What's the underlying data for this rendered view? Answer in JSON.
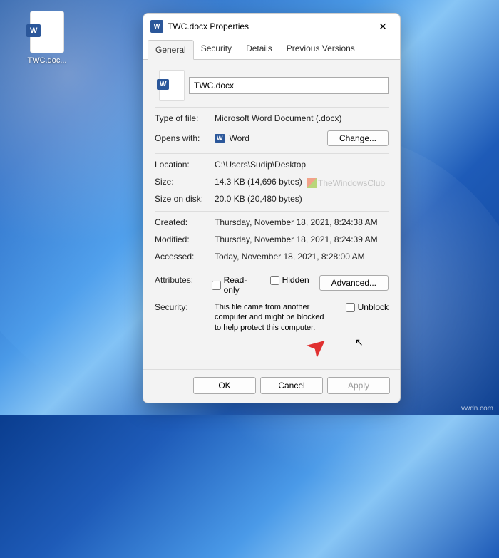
{
  "desktop": {
    "file_label": "TWC.doc..."
  },
  "dialog": {
    "title": "TWC.docx Properties",
    "close": "✕",
    "tabs": {
      "general": "General",
      "security": "Security",
      "details": "Details",
      "previous": "Previous Versions"
    },
    "filename": "TWC.docx",
    "type": {
      "label": "Type of file:",
      "value": "Microsoft Word Document (.docx)"
    },
    "opens": {
      "label": "Opens with:",
      "app": "Word",
      "change": "Change..."
    },
    "location": {
      "label": "Location:",
      "value": "C:\\Users\\Sudip\\Desktop"
    },
    "size": {
      "label": "Size:",
      "value": "14.3 KB (14,696 bytes)"
    },
    "disk": {
      "label": "Size on disk:",
      "value": "20.0 KB (20,480 bytes)"
    },
    "created": {
      "label": "Created:",
      "value": "Thursday, November 18, 2021, 8:24:38 AM"
    },
    "modified": {
      "label": "Modified:",
      "value": "Thursday, November 18, 2021, 8:24:39 AM"
    },
    "accessed": {
      "label": "Accessed:",
      "value": "Today, November 18, 2021, 8:28:00 AM"
    },
    "attributes": {
      "label": "Attributes:",
      "readonly": "Read-only",
      "hidden": "Hidden",
      "advanced": "Advanced..."
    },
    "securityrow": {
      "label": "Security:",
      "text": "This file came from another computer and might be blocked to help protect this computer.",
      "unblock": "Unblock"
    },
    "buttons": {
      "ok": "OK",
      "cancel": "Cancel",
      "apply": "Apply"
    }
  },
  "watermark": "TheWindowsClub",
  "attribution": "vwdn.com"
}
